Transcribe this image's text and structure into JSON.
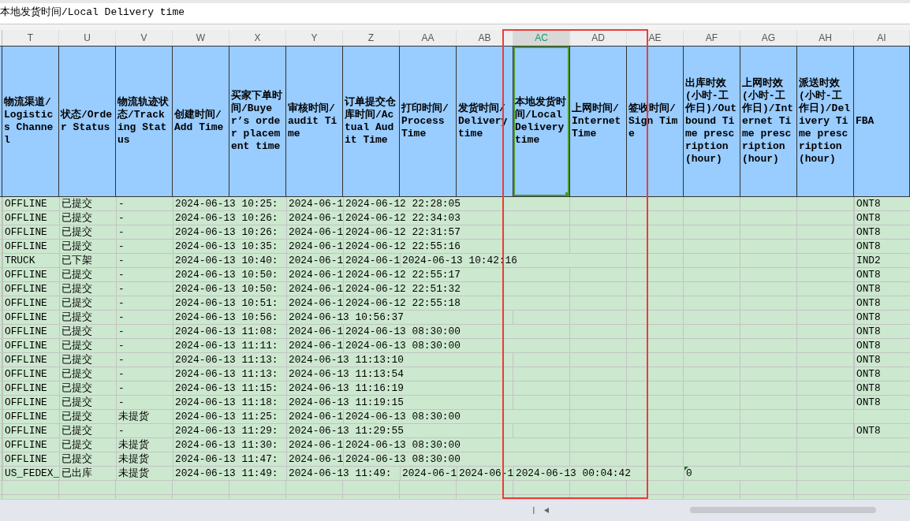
{
  "formula_bar": {
    "value": "本地发货时间/Local Delivery time"
  },
  "columns": [
    {
      "letter": "T",
      "label": "物流渠道/Logistics Channel",
      "selected": false
    },
    {
      "letter": "U",
      "label": "状态/Order Status",
      "selected": false
    },
    {
      "letter": "V",
      "label": "物流轨迹状态/Tracking Status",
      "selected": false
    },
    {
      "letter": "W",
      "label": "创建时间/Add Time",
      "selected": false
    },
    {
      "letter": "X",
      "label": "买家下单时间/Buyer’s order placement time",
      "selected": false
    },
    {
      "letter": "Y",
      "label": "审核时间/audit Time",
      "selected": false
    },
    {
      "letter": "Z",
      "label": "订单提交仓库时间/Actual Audit Time",
      "selected": false
    },
    {
      "letter": "AA",
      "label": "打印时间/Process Time",
      "selected": false
    },
    {
      "letter": "AB",
      "label": "发货时间/Delivery time",
      "selected": false
    },
    {
      "letter": "AC",
      "label": "本地发货时间/Local Delivery time",
      "selected": true
    },
    {
      "letter": "AD",
      "label": "上网时间/Internet Time",
      "selected": false
    },
    {
      "letter": "AE",
      "label": "签收时间/Sign Time",
      "selected": false
    },
    {
      "letter": "AF",
      "label": "出库时效(小时-工作日)/Outbound Time prescription(hour)",
      "selected": false
    },
    {
      "letter": "AG",
      "label": "上网时效(小时-工作日)/Internet Time prescription(hour)",
      "selected": false
    },
    {
      "letter": "AH",
      "label": "派送时效(小时-工作日)/Delivery Time prescription(hour)",
      "selected": false
    },
    {
      "letter": "AI",
      "label": "FBA",
      "selected": false
    }
  ],
  "rows": [
    {
      "cells": {
        "T": "OFFLINE",
        "U": "已提交",
        "V": "-",
        "W": "2024-06-13 10:25:",
        "Y": "2024-06-1",
        "Z": "2024-06-12 22:28:05",
        "AI": "ONT8"
      }
    },
    {
      "cells": {
        "T": "OFFLINE",
        "U": "已提交",
        "V": "-",
        "W": "2024-06-13 10:26:",
        "Y": "2024-06-1",
        "Z": "2024-06-12 22:34:03",
        "AI": "ONT8"
      }
    },
    {
      "cells": {
        "T": "OFFLINE",
        "U": "已提交",
        "V": "-",
        "W": "2024-06-13 10:26:",
        "Y": "2024-06-1",
        "Z": "2024-06-12 22:31:57",
        "AI": "ONT8"
      }
    },
    {
      "cells": {
        "T": "OFFLINE",
        "U": "已提交",
        "V": "-",
        "W": "2024-06-13 10:35:",
        "Y": "2024-06-1",
        "Z": "2024-06-12 22:55:16",
        "AI": "ONT8"
      }
    },
    {
      "cells": {
        "T": "TRUCK",
        "U": "已下架",
        "V": "-",
        "W": "2024-06-13 10:40:",
        "Y": "2024-06-1",
        "Z": "2024-06-1",
        "AA": "2024-06-13 10:42:16",
        "AI": "IND2"
      }
    },
    {
      "cells": {
        "T": "OFFLINE",
        "U": "已提交",
        "V": "-",
        "W": "2024-06-13 10:50:",
        "Y": "2024-06-1",
        "Z": "2024-06-12 22:55:17",
        "AI": "ONT8"
      }
    },
    {
      "cells": {
        "T": "OFFLINE",
        "U": "已提交",
        "V": "-",
        "W": "2024-06-13 10:50:",
        "Y": "2024-06-1",
        "Z": "2024-06-12 22:51:32",
        "AI": "ONT8"
      }
    },
    {
      "cells": {
        "T": "OFFLINE",
        "U": "已提交",
        "V": "-",
        "W": "2024-06-13 10:51:",
        "Y": "2024-06-1",
        "Z": "2024-06-12 22:55:18",
        "AI": "ONT8"
      }
    },
    {
      "cells": {
        "T": "OFFLINE",
        "U": "已提交",
        "V": "-",
        "W": "2024-06-13 10:56:",
        "Y": "2024-06-13 10:56:37",
        "AI": "ONT8"
      }
    },
    {
      "cells": {
        "T": "OFFLINE",
        "U": "已提交",
        "V": "-",
        "W": "2024-06-13 11:08:",
        "Y": "2024-06-1",
        "Z": "2024-06-13 08:30:00",
        "AI": "ONT8"
      }
    },
    {
      "cells": {
        "T": "OFFLINE",
        "U": "已提交",
        "V": "-",
        "W": "2024-06-13 11:11:",
        "Y": "2024-06-1",
        "Z": "2024-06-13 08:30:00",
        "AI": "ONT8"
      }
    },
    {
      "cells": {
        "T": "OFFLINE",
        "U": "已提交",
        "V": "-",
        "W": "2024-06-13 11:13:",
        "Y": "2024-06-13 11:13:10",
        "AI": "ONT8"
      }
    },
    {
      "cells": {
        "T": "OFFLINE",
        "U": "已提交",
        "V": "-",
        "W": "2024-06-13 11:13:",
        "Y": "2024-06-13 11:13:54",
        "AI": "ONT8"
      }
    },
    {
      "cells": {
        "T": "OFFLINE",
        "U": "已提交",
        "V": "-",
        "W": "2024-06-13 11:15:",
        "Y": "2024-06-13 11:16:19",
        "AI": "ONT8"
      }
    },
    {
      "cells": {
        "T": "OFFLINE",
        "U": "已提交",
        "V": "-",
        "W": "2024-06-13 11:18:",
        "Y": "2024-06-13 11:19:15",
        "AI": "ONT8"
      }
    },
    {
      "cells": {
        "T": "OFFLINE",
        "U": "已提交",
        "V": "未提货",
        "W": "2024-06-13 11:25:",
        "Y": "2024-06-1",
        "Z": "2024-06-13 08:30:00"
      }
    },
    {
      "cells": {
        "T": "OFFLINE",
        "U": "已提交",
        "V": "-",
        "W": "2024-06-13 11:29:",
        "Y": "2024-06-13 11:29:55",
        "AI": "ONT8"
      }
    },
    {
      "cells": {
        "T": "OFFLINE",
        "U": "已提交",
        "V": "未提货",
        "W": "2024-06-13 11:30:",
        "Y": "2024-06-1",
        "Z": "2024-06-13 08:30:00"
      }
    },
    {
      "cells": {
        "T": "OFFLINE",
        "U": "已提交",
        "V": "未提货",
        "W": "2024-06-13 11:47:",
        "Y": "2024-06-1",
        "Z": "2024-06-13 08:30:00"
      }
    },
    {
      "cells": {
        "T": "US_FEDEX_",
        "U": "已出库",
        "V": "未提货",
        "W": "2024-06-13 11:49:",
        "Y": "2024-06-13 11:49:",
        "AA": "2024-06-1",
        "AB": "2024-06-1",
        "AC": "2024-06-13 00:04:42",
        "AF": {
          "text": "0",
          "warning": true
        }
      }
    },
    {
      "cells": {}
    },
    {
      "cells": {}
    }
  ]
}
